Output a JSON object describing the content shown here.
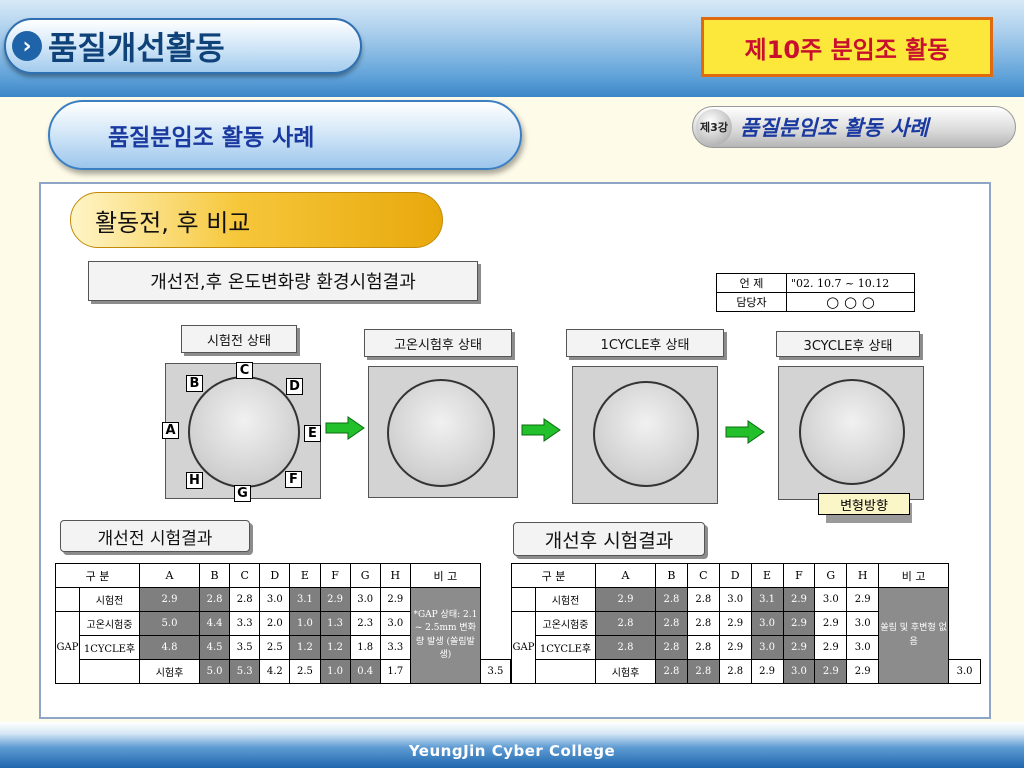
{
  "header": {
    "title": "품질개선활동",
    "title_arrow": "›",
    "week_label": "제10주 분임조 활동"
  },
  "subheader": {
    "title": "품질분임조 활동 사례",
    "lecture_number": "제3강",
    "lecture_title": "품질분임조 활동 사례"
  },
  "section": {
    "title": "활동전, 후 비교",
    "subtitle": "개선전,후 온도변화량 환경시험결과"
  },
  "info": {
    "date_label": "언 제",
    "date_value": "\"02.  10.7 ~ 10.12",
    "person_label": "담당자",
    "person_value": "○ ○ ○"
  },
  "stages": [
    {
      "label": "시험전 상태"
    },
    {
      "label": "고온시험후 상태"
    },
    {
      "label": "1CYCLE후 상태"
    },
    {
      "label": "3CYCLE후 상태"
    }
  ],
  "point_tags": [
    "A",
    "B",
    "C",
    "D",
    "E",
    "F",
    "G",
    "H"
  ],
  "deform_label": "변형방향",
  "before": {
    "title": "개선전 시험결과",
    "header": [
      "구 분",
      "A",
      "B",
      "C",
      "D",
      "E",
      "F",
      "G",
      "H",
      "비 고"
    ],
    "group_label": "GAP",
    "rows": [
      {
        "name": "시험전",
        "values": [
          "2.9",
          "2.8",
          "2.8",
          "3.0",
          "3.1",
          "2.9",
          "3.0",
          "2.9"
        ]
      },
      {
        "name": "고온시험중",
        "values": [
          "5.0",
          "4.4",
          "3.3",
          "2.0",
          "1.0",
          "1.3",
          "2.3",
          "3.0"
        ]
      },
      {
        "name": "1CYCLE후",
        "values": [
          "4.8",
          "4.5",
          "3.5",
          "2.5",
          "1.2",
          "1.2",
          "1.8",
          "3.3"
        ]
      },
      {
        "name": "시험후",
        "values": [
          "5.0",
          "5.3",
          "4.2",
          "2.5",
          "1.0",
          "0.4",
          "1.7",
          "3.5"
        ]
      }
    ],
    "note": "*GAP 상태: 2.1 ~ 2.5mm 변화량 발생 (쏠림발생)"
  },
  "after": {
    "title": "개선후 시험결과",
    "header": [
      "구 분",
      "A",
      "B",
      "C",
      "D",
      "E",
      "F",
      "G",
      "H",
      "비 고"
    ],
    "group_label": "GAP",
    "rows": [
      {
        "name": "시험전",
        "values": [
          "2.9",
          "2.8",
          "2.8",
          "3.0",
          "3.1",
          "2.9",
          "3.0",
          "2.9"
        ]
      },
      {
        "name": "고온시험중",
        "values": [
          "2.8",
          "2.8",
          "2.8",
          "2.9",
          "3.0",
          "2.9",
          "2.9",
          "3.0"
        ]
      },
      {
        "name": "1CYCLE후",
        "values": [
          "2.8",
          "2.8",
          "2.8",
          "2.9",
          "3.0",
          "2.9",
          "2.9",
          "3.0"
        ]
      },
      {
        "name": "시험후",
        "values": [
          "2.8",
          "2.8",
          "2.8",
          "2.9",
          "3.0",
          "2.9",
          "2.9",
          "3.0"
        ]
      }
    ],
    "note": "쏠림 및 후변형 없음"
  },
  "footer": {
    "college": "YeungJin Cyber College"
  },
  "colors": {
    "accent_blue": "#1a3aa0",
    "week_text": "#c8102e",
    "week_bg": "#fbe83a",
    "arrow_green": "#22c02a"
  }
}
